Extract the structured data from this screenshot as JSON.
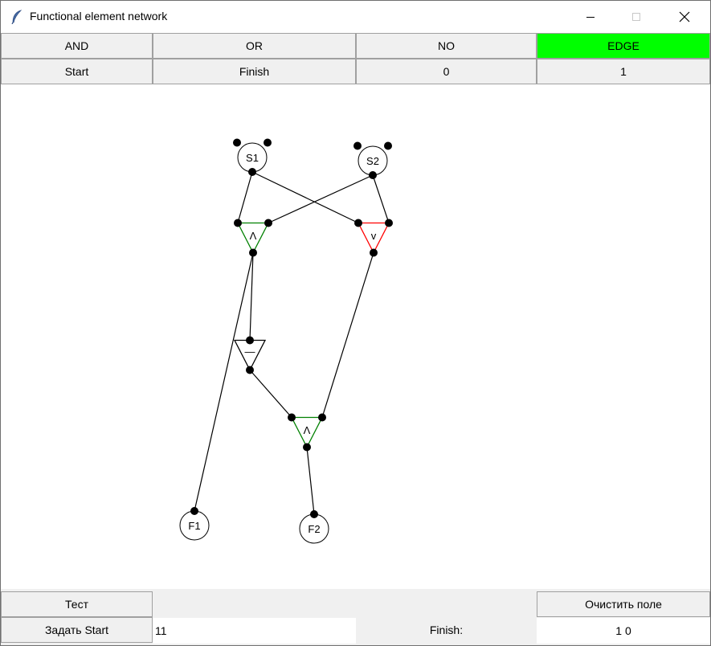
{
  "window": {
    "title": "Functional element network",
    "icon": "feather-icon"
  },
  "toolbar": {
    "row1": [
      {
        "label": "AND",
        "active": false
      },
      {
        "label": "OR",
        "active": false
      },
      {
        "label": "NO",
        "active": false
      },
      {
        "label": "EDGE",
        "active": true
      }
    ],
    "row2": [
      {
        "label": "Start"
      },
      {
        "label": "Finish"
      },
      {
        "label": "0"
      },
      {
        "label": "1"
      }
    ],
    "active_color": "#00ff00"
  },
  "network": {
    "nodes": [
      {
        "id": "S1",
        "label": "S1",
        "kind": "start"
      },
      {
        "id": "S2",
        "label": "S2",
        "kind": "start"
      },
      {
        "id": "AND1",
        "label": "Λ",
        "kind": "and",
        "color": "#008000"
      },
      {
        "id": "OR1",
        "label": "v",
        "kind": "or",
        "color": "#ff0000"
      },
      {
        "id": "NOT1",
        "label": "—",
        "kind": "not",
        "color": "#000000"
      },
      {
        "id": "AND2",
        "label": "Λ",
        "kind": "and",
        "color": "#008000"
      },
      {
        "id": "F1",
        "label": "F1",
        "kind": "finish"
      },
      {
        "id": "F2",
        "label": "F2",
        "kind": "finish"
      }
    ],
    "edges": [
      {
        "from": "S1",
        "to": "AND1"
      },
      {
        "from": "S1",
        "to": "OR1"
      },
      {
        "from": "S2",
        "to": "AND1"
      },
      {
        "from": "S2",
        "to": "OR1"
      },
      {
        "from": "AND1",
        "to": "NOT1"
      },
      {
        "from": "AND1",
        "to": "F1"
      },
      {
        "from": "NOT1",
        "to": "AND2"
      },
      {
        "from": "OR1",
        "to": "AND2"
      },
      {
        "from": "AND2",
        "to": "F2"
      }
    ]
  },
  "bottom": {
    "test_label": "Тест",
    "clear_label": "Очистить поле",
    "set_start_label": "Задать Start",
    "start_value": "11",
    "finish_label": "Finish:",
    "finish_value": "1 0"
  }
}
